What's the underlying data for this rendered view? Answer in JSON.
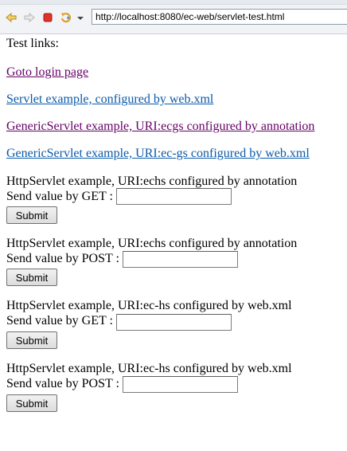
{
  "browser": {
    "url": "http://localhost:8080/ec-web/servlet-test.html"
  },
  "page": {
    "heading": "Test links:",
    "links": [
      {
        "label": "Goto login page"
      },
      {
        "label": "Servlet example, configured by web.xml"
      },
      {
        "label": "GenericServlet example, URI:ecgs configured by annotation"
      },
      {
        "label": "GenericServlet example, URI:ec-gs configured by web.xml"
      }
    ],
    "forms": [
      {
        "title": "HttpServlet example, URI:echs configured by annotation",
        "prompt": "Send value by GET :",
        "value": "",
        "submit": "Submit"
      },
      {
        "title": "HttpServlet example, URI:echs configured by annotation",
        "prompt": "Send value by POST :",
        "value": "",
        "submit": "Submit"
      },
      {
        "title": "HttpServlet example, URI:ec-hs configured by web.xml",
        "prompt": "Send value by GET :",
        "value": "",
        "submit": "Submit"
      },
      {
        "title": "HttpServlet example, URI:ec-hs configured by web.xml",
        "prompt": "Send value by POST :",
        "value": "",
        "submit": "Submit"
      }
    ]
  },
  "colors": {
    "link_visited": "#660066",
    "link_unvisited": "#0b5aa9"
  },
  "icons": [
    "back-icon",
    "forward-icon",
    "stop-icon",
    "reload-icon",
    "dropdown-icon"
  ]
}
